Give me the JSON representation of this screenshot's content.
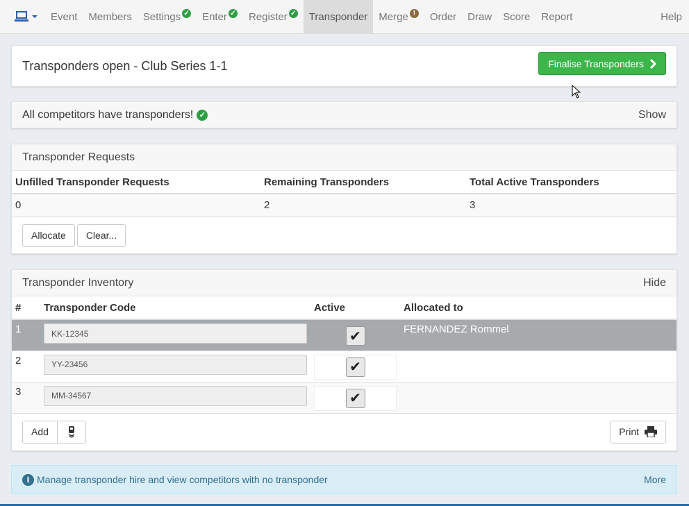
{
  "navbar": {
    "items": [
      {
        "label": "Event",
        "badge": ""
      },
      {
        "label": "Members",
        "badge": ""
      },
      {
        "label": "Settings",
        "badge": "ok"
      },
      {
        "label": "Enter",
        "badge": "ok"
      },
      {
        "label": "Register",
        "badge": "ok"
      },
      {
        "label": "Transponder",
        "badge": "",
        "active": true
      },
      {
        "label": "Merge",
        "badge": "warn"
      },
      {
        "label": "Order",
        "badge": ""
      },
      {
        "label": "Draw",
        "badge": ""
      },
      {
        "label": "Score",
        "badge": ""
      },
      {
        "label": "Report",
        "badge": ""
      }
    ],
    "help": "Help",
    "brand_icon": "laptop-icon",
    "brand_color": "#2a5fb0"
  },
  "header_panel": {
    "title": "Transponders open - Club Series 1-1",
    "finalise_label": "Finalise Transponders"
  },
  "status_panel": {
    "message": "All competitors have transponders!",
    "toggle": "Show"
  },
  "requests_panel": {
    "title": "Transponder Requests",
    "columns": [
      "Unfilled Transponder Requests",
      "Remaining Transponders",
      "Total Active Transponders"
    ],
    "values": [
      "0",
      "2",
      "3"
    ],
    "allocate_label": "Allocate",
    "clear_label": "Clear..."
  },
  "inventory_panel": {
    "title": "Transponder Inventory",
    "toggle": "Hide",
    "columns": [
      "#",
      "Transponder Code",
      "Active",
      "Allocated to"
    ],
    "rows": [
      {
        "num": "1",
        "code": "KK-12345",
        "active": true,
        "allocated": "FERNANDEZ Rommel"
      },
      {
        "num": "2",
        "code": "YY-23456",
        "active": true,
        "allocated": ""
      },
      {
        "num": "3",
        "code": "MM-34567",
        "active": true,
        "allocated": ""
      }
    ],
    "add_label": "Add",
    "print_label": "Print"
  },
  "info_bar": {
    "message": "Manage transponder hire and view competitors with no transponder",
    "more": "More"
  },
  "colors": {
    "success": "#3cb54a",
    "info_bg": "#d9edf7",
    "info_text": "#31708f",
    "selected_row": "#a7aaad"
  }
}
